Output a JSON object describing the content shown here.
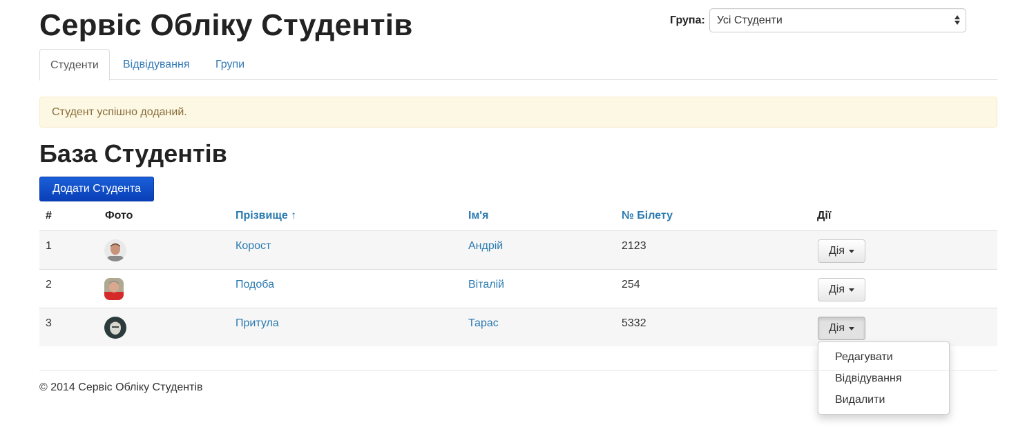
{
  "header": {
    "title": "Сервіс Обліку Студентів",
    "group_label": "Група:",
    "group_selected": "Усі Студенти"
  },
  "tabs": [
    {
      "label": "Студенти",
      "active": true
    },
    {
      "label": "Відвідування",
      "active": false
    },
    {
      "label": "Групи",
      "active": false
    }
  ],
  "alert": {
    "text": "Студент успішно доданий."
  },
  "main": {
    "title": "База Студентів",
    "add_button": "Додати Студента"
  },
  "table": {
    "headers": [
      "#",
      "Фото",
      "Прізвище ↑",
      "Ім'я",
      "№ Білету",
      "Дії"
    ],
    "rows": [
      {
        "num": "1",
        "last_name": "Короcт",
        "first_name": "Андрій",
        "ticket": "2123",
        "action": "Дія"
      },
      {
        "num": "2",
        "last_name": "Подоба",
        "first_name": "Віталій",
        "ticket": "254",
        "action": "Дія"
      },
      {
        "num": "3",
        "last_name": "Притула",
        "first_name": "Тарас",
        "ticket": "5332",
        "action": "Дія"
      }
    ]
  },
  "dropdown": {
    "items": [
      "Редагувати",
      "Відвідування",
      "Видалити"
    ]
  },
  "footer": {
    "text": "© 2014 Сервіс Обліку Студентів"
  },
  "colors": {
    "link": "#2a7ab0",
    "primary_button": "#0a3fb8",
    "alert_bg": "#fcf8e3",
    "alert_text": "#8a6d3b"
  }
}
